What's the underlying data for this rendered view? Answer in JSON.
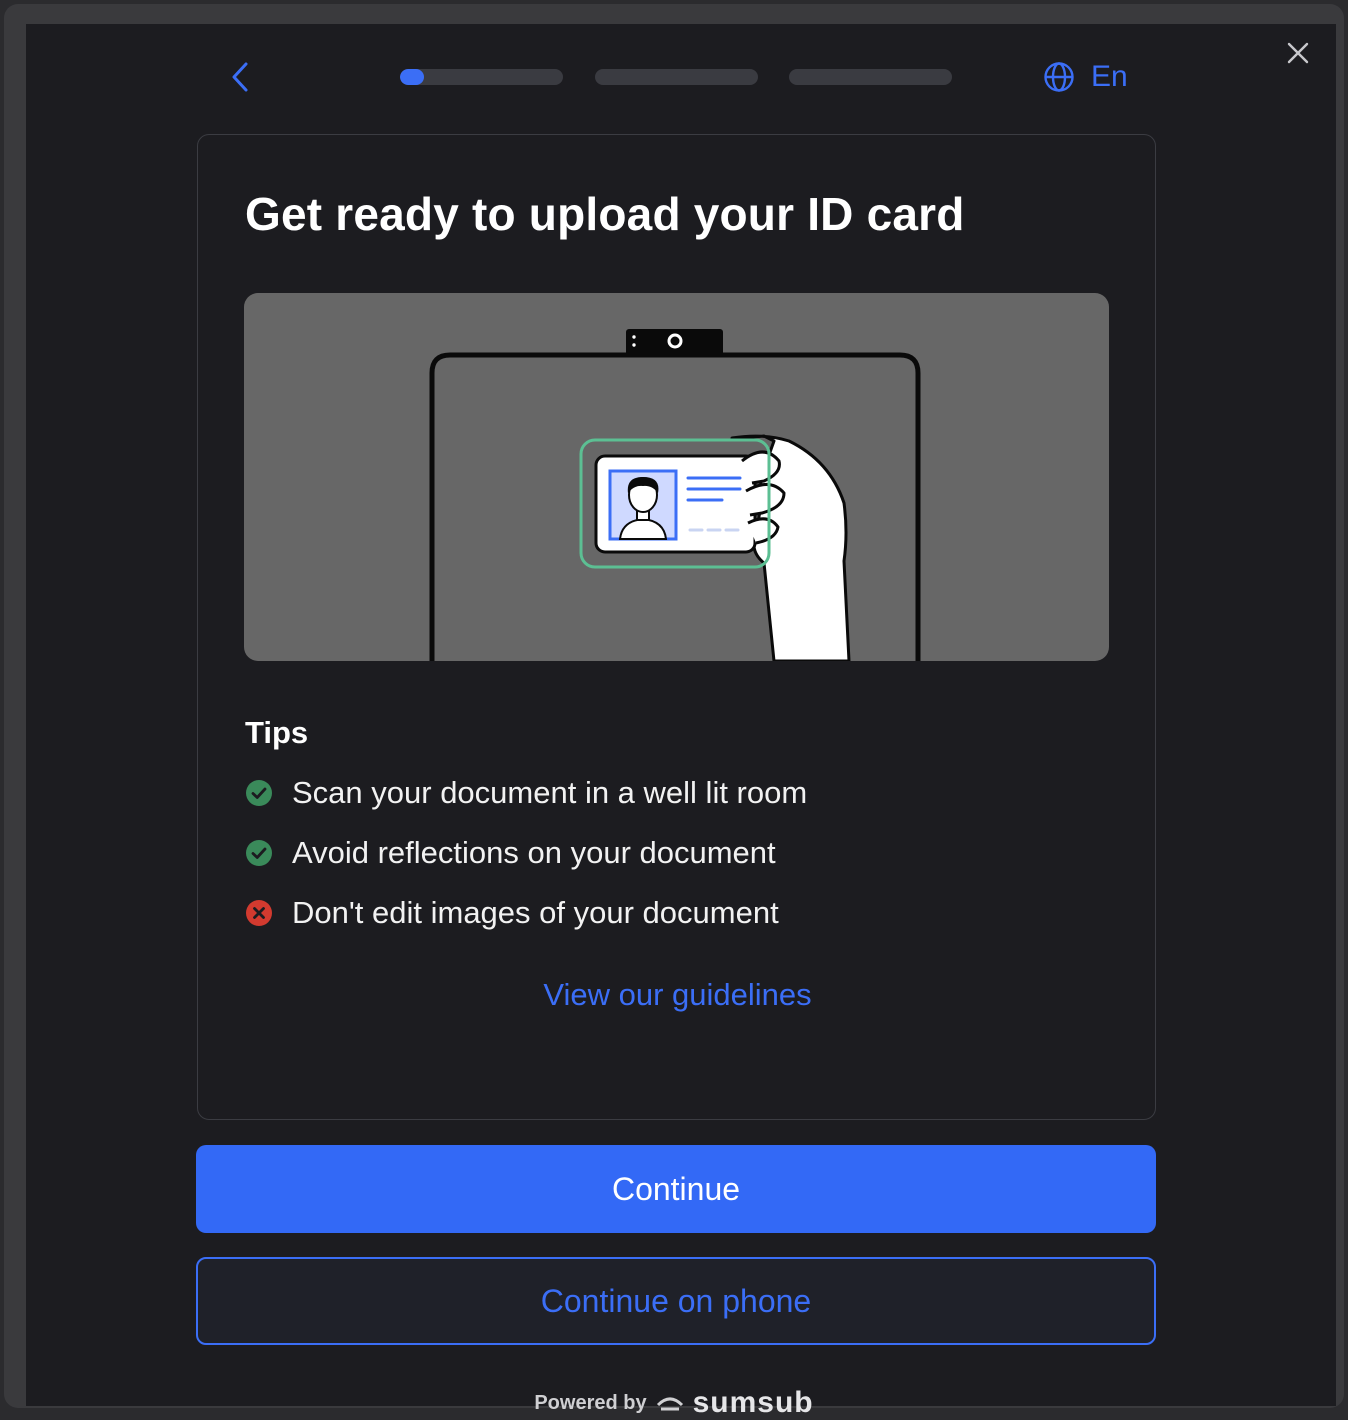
{
  "header": {
    "back_icon": "chevron-left-icon",
    "close_icon": "close-icon",
    "progress": {
      "steps": 3,
      "current_step_fraction": 0.15
    },
    "language": {
      "icon": "globe-icon",
      "label": "En"
    }
  },
  "card": {
    "title": "Get ready to upload your ID card",
    "illustration": "id-card-illustration",
    "tips_title": "Tips",
    "tips": [
      {
        "text": "Scan your document in a well lit room",
        "type": "do",
        "icon": "check-circle-icon"
      },
      {
        "text": "Avoid reflections on your document",
        "type": "do",
        "icon": "check-circle-icon"
      },
      {
        "text": "Don't edit images of your document",
        "type": "dont",
        "icon": "x-circle-icon"
      }
    ],
    "guidelines_link": "View our guidelines"
  },
  "actions": {
    "continue_label": "Continue",
    "continue_on_phone_label": "Continue on phone"
  },
  "footer": {
    "powered_by": "Powered by",
    "brand": "sumsub"
  },
  "colors": {
    "accent": "#3b6ef6",
    "success": "#3a8a5a",
    "error": "#d23a2f",
    "background": "#1c1c20"
  }
}
